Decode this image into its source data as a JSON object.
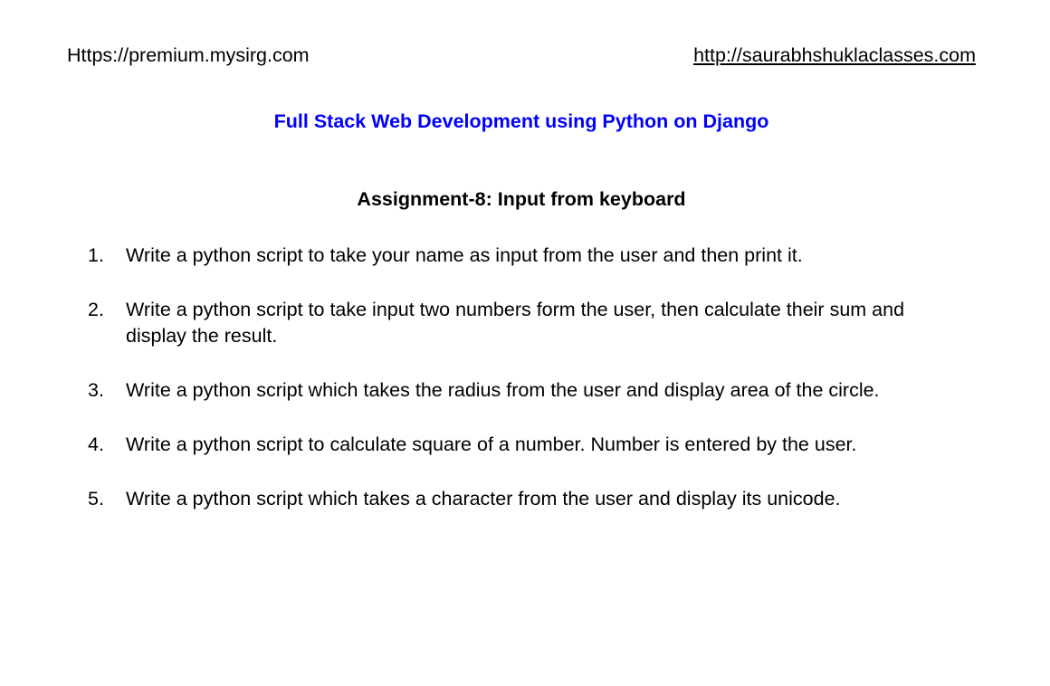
{
  "header": {
    "left_url": "Https://premium.mysirg.com",
    "right_url": "http://saurabhshuklaclasses.com"
  },
  "course_title": "Full Stack Web Development using Python on Django",
  "assignment_title": "Assignment-8: Input from keyboard",
  "colors": {
    "course_title": "#0000ff"
  },
  "questions": [
    {
      "number": "1.",
      "text": "Write a python script to take your name as input from the user and then print it."
    },
    {
      "number": "2.",
      "text": "Write a python script to take input two numbers form the user, then calculate their sum and display the result."
    },
    {
      "number": "3.",
      "text": "Write a python script which takes the radius from the user and display area of the circle."
    },
    {
      "number": "4.",
      "text": "Write a python script to calculate square of a number. Number is entered by the user."
    },
    {
      "number": "5.",
      "text": "Write a python script which takes a character from the user and display its unicode."
    }
  ]
}
